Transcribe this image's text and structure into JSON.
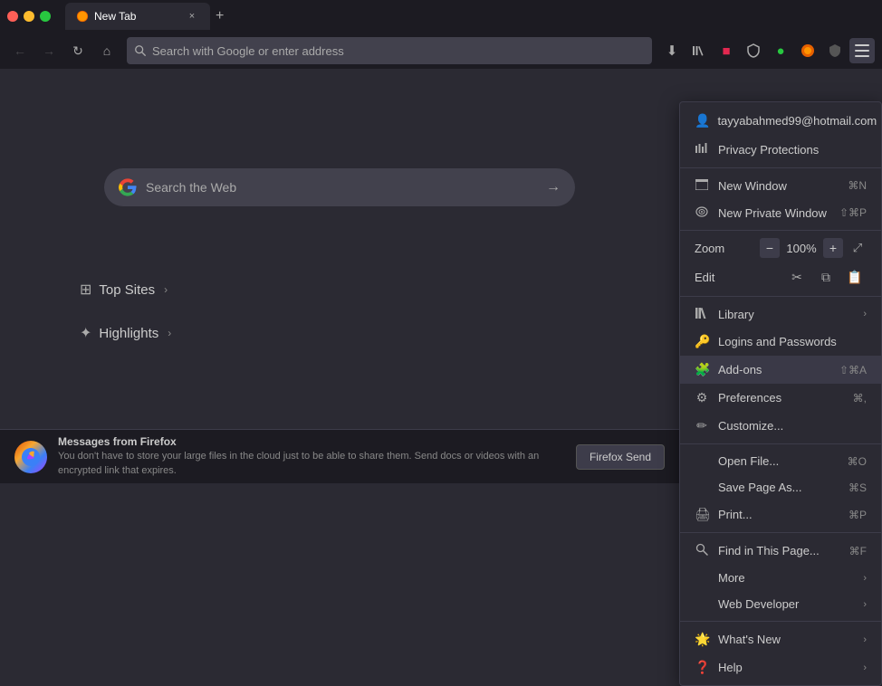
{
  "window": {
    "title": "New Tab",
    "controls": {
      "close": "×",
      "minimize": "−",
      "maximize": "+"
    }
  },
  "tabs": [
    {
      "label": "New Tab",
      "active": true,
      "favicon": "🦊"
    }
  ],
  "nav": {
    "back_disabled": true,
    "forward_disabled": true,
    "search_placeholder": "Search with Google or enter address"
  },
  "toolbar": {
    "download_icon": "⬇",
    "library_icon": "📚",
    "pocket_icon": "🔴",
    "shield_icon": "🛡",
    "monitor_icon": "🟢",
    "fox_icon": "🦊",
    "shield2_icon": "🛡",
    "menu_icon": "☰"
  },
  "google_search": {
    "placeholder": "Search the Web"
  },
  "sections": [
    {
      "id": "top-sites",
      "icon": "⊞",
      "label": "Top Sites",
      "has_arrow": true
    },
    {
      "id": "highlights",
      "icon": "✦",
      "label": "Highlights",
      "has_arrow": true
    }
  ],
  "notification": {
    "title": "Messages from Firefox",
    "text": "You don't have to store your large files in the cloud just to be able to share them. Send docs or videos with an encrypted link that expires.",
    "button_label": "Firefox Send"
  },
  "menu": {
    "account": {
      "email": "tayyabahmed99@hotmail.com",
      "has_arrow": true
    },
    "privacy_protections": {
      "label": "Privacy Protections",
      "icon": "📊"
    },
    "items": [
      {
        "id": "new-window",
        "icon": "🖥",
        "label": "New Window",
        "shortcut": "⌘N",
        "has_arrow": false
      },
      {
        "id": "new-private-window",
        "icon": "🕶",
        "label": "New Private Window",
        "shortcut": "⇧⌘P",
        "has_arrow": false
      },
      {
        "id": "zoom",
        "label": "Zoom",
        "minus": "−",
        "value": "100%",
        "plus": "+",
        "expand": "⤢"
      },
      {
        "id": "edit",
        "label": "Edit",
        "cut": "✂",
        "copy": "⧉",
        "paste": "📋"
      },
      {
        "id": "library",
        "icon": "📚",
        "label": "Library",
        "has_arrow": true
      },
      {
        "id": "logins-passwords",
        "icon": "🔑",
        "label": "Logins and Passwords",
        "has_arrow": false
      },
      {
        "id": "add-ons",
        "icon": "🧩",
        "label": "Add-ons",
        "shortcut": "⇧⌘A",
        "highlighted": true
      },
      {
        "id": "preferences",
        "icon": "⚙",
        "label": "Preferences",
        "shortcut": "⌘,"
      },
      {
        "id": "customize",
        "icon": "✏",
        "label": "Customize..."
      },
      {
        "id": "open-file",
        "label": "Open File...",
        "shortcut": "⌘O"
      },
      {
        "id": "save-page-as",
        "label": "Save Page As...",
        "shortcut": "⌘S"
      },
      {
        "id": "print",
        "icon": "🖨",
        "label": "Print...",
        "shortcut": "⌘P"
      },
      {
        "id": "find-in-page",
        "icon": "🔍",
        "label": "Find in This Page...",
        "shortcut": "⌘F"
      },
      {
        "id": "more",
        "label": "More",
        "has_arrow": true
      },
      {
        "id": "web-developer",
        "label": "Web Developer",
        "has_arrow": true
      },
      {
        "id": "whats-new",
        "icon": "🌟",
        "label": "What's New",
        "has_arrow": true
      },
      {
        "id": "help",
        "icon": "❓",
        "label": "Help",
        "has_arrow": true
      }
    ]
  }
}
